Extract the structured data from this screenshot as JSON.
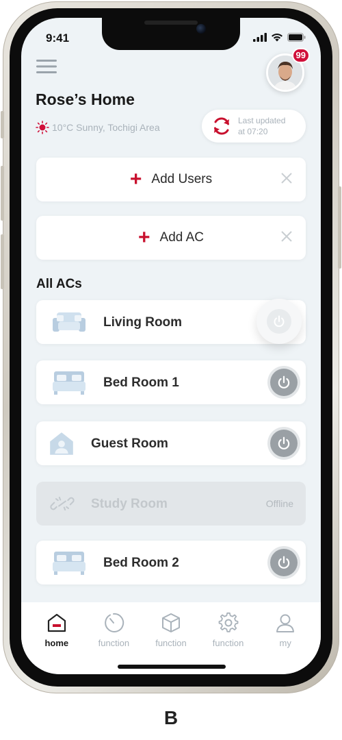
{
  "status_bar": {
    "time": "9:41"
  },
  "header": {
    "notification_count": "99",
    "home_name": "Rose’s Home",
    "weather": "10°C Sunny, Tochigi Area",
    "last_updated_line1": "Last updated",
    "last_updated_line2": "at 07:20"
  },
  "actions": {
    "add_users": "Add Users",
    "add_ac": "Add AC"
  },
  "section_title": "All ACs",
  "rooms": [
    {
      "name": "Living Room",
      "icon": "sofa-icon",
      "status": "active"
    },
    {
      "name": "Bed Room 1",
      "icon": "bed-icon",
      "status": "online"
    },
    {
      "name": "Guest Room",
      "icon": "guest-house-icon",
      "status": "online"
    },
    {
      "name": "Study Room",
      "icon": "broken-link-icon",
      "status": "Offline"
    },
    {
      "name": "Bed Room 2",
      "icon": "bed-icon",
      "status": "online"
    }
  ],
  "nav": [
    {
      "label": "home",
      "icon": "home-icon",
      "active": true
    },
    {
      "label": "function",
      "icon": "timer-icon",
      "active": false
    },
    {
      "label": "function",
      "icon": "cube-icon",
      "active": false
    },
    {
      "label": "function",
      "icon": "gear-icon",
      "active": false
    },
    {
      "label": "my",
      "icon": "user-icon",
      "active": false
    }
  ],
  "caption": "B",
  "colors": {
    "accent": "#c8102e",
    "background": "#eef3f6",
    "muted": "#a9b2ba"
  }
}
